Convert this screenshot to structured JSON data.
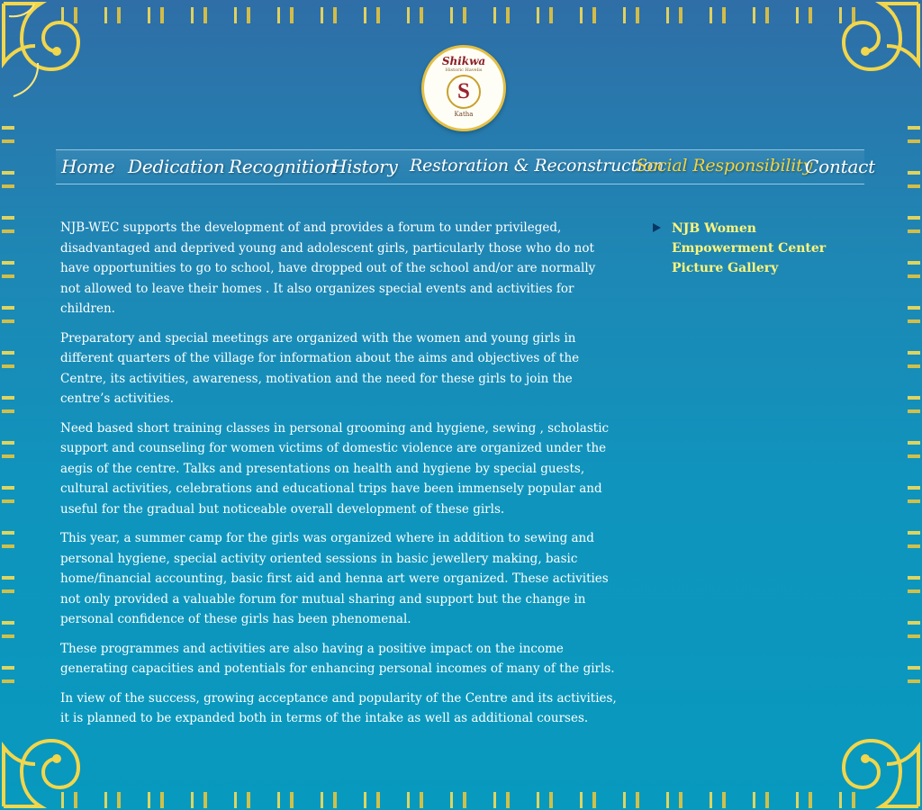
{
  "logo": {
    "brand": "Shikwa",
    "tagline": "Historic Havelis",
    "monogram": "S",
    "place": "Katha"
  },
  "nav": {
    "items": [
      {
        "label": "Home"
      },
      {
        "label": "Dedication"
      },
      {
        "label": "Recognition"
      },
      {
        "label": "History"
      },
      {
        "label": "Restoration & Reconstruction"
      },
      {
        "label": "Social Responsibility"
      },
      {
        "label": "Contact"
      }
    ]
  },
  "main": {
    "paragraphs": [
      "NJB-WEC supports the development of and provides a forum to under privileged, disadvantaged and deprived young and adolescent girls, particularly those who do not have opportunities to go to school, have dropped out of the school and/or are normally not allowed to leave their homes . It also organizes special events and activities for children.",
      "Preparatory and special meetings are organized with the women and young girls in different quarters of the village for information about the aims and objectives of the Centre, its activities, awareness, motivation and the need for these girls to join the centre’s activities.",
      "Need based short training classes in personal grooming and hygiene, sewing , scholastic support and counseling for women victims of domestic violence are organized under the aegis of the centre. Talks and presentations on health and hygiene by special guests, cultural activities, celebrations and educational trips have been immensely popular and useful for the gradual but noticeable overall development of these girls.",
      "This year, a summer camp for the girls was organized where in addition to sewing and personal hygiene, special activity oriented sessions in basic jewellery making, basic home/financial accounting, basic first aid and henna art were organized. These activities not only provided a valuable forum for mutual sharing and support but the change in personal confidence of these girls has been phenomenal.",
      "These programmes and activities are also having a positive impact on the income generating capacities and potentials for enhancing personal incomes of many of the girls.",
      "In view of the success, growing acceptance and popularity of the Centre and its activities, it is planned to be expanded both in terms of the intake as well as additional courses."
    ]
  },
  "sidebar": {
    "link_label": "NJB Women Empowerment Center Picture Gallery"
  },
  "colors": {
    "accent": "#f4d33c",
    "link": "#fff47a",
    "text": "#ffffff"
  }
}
